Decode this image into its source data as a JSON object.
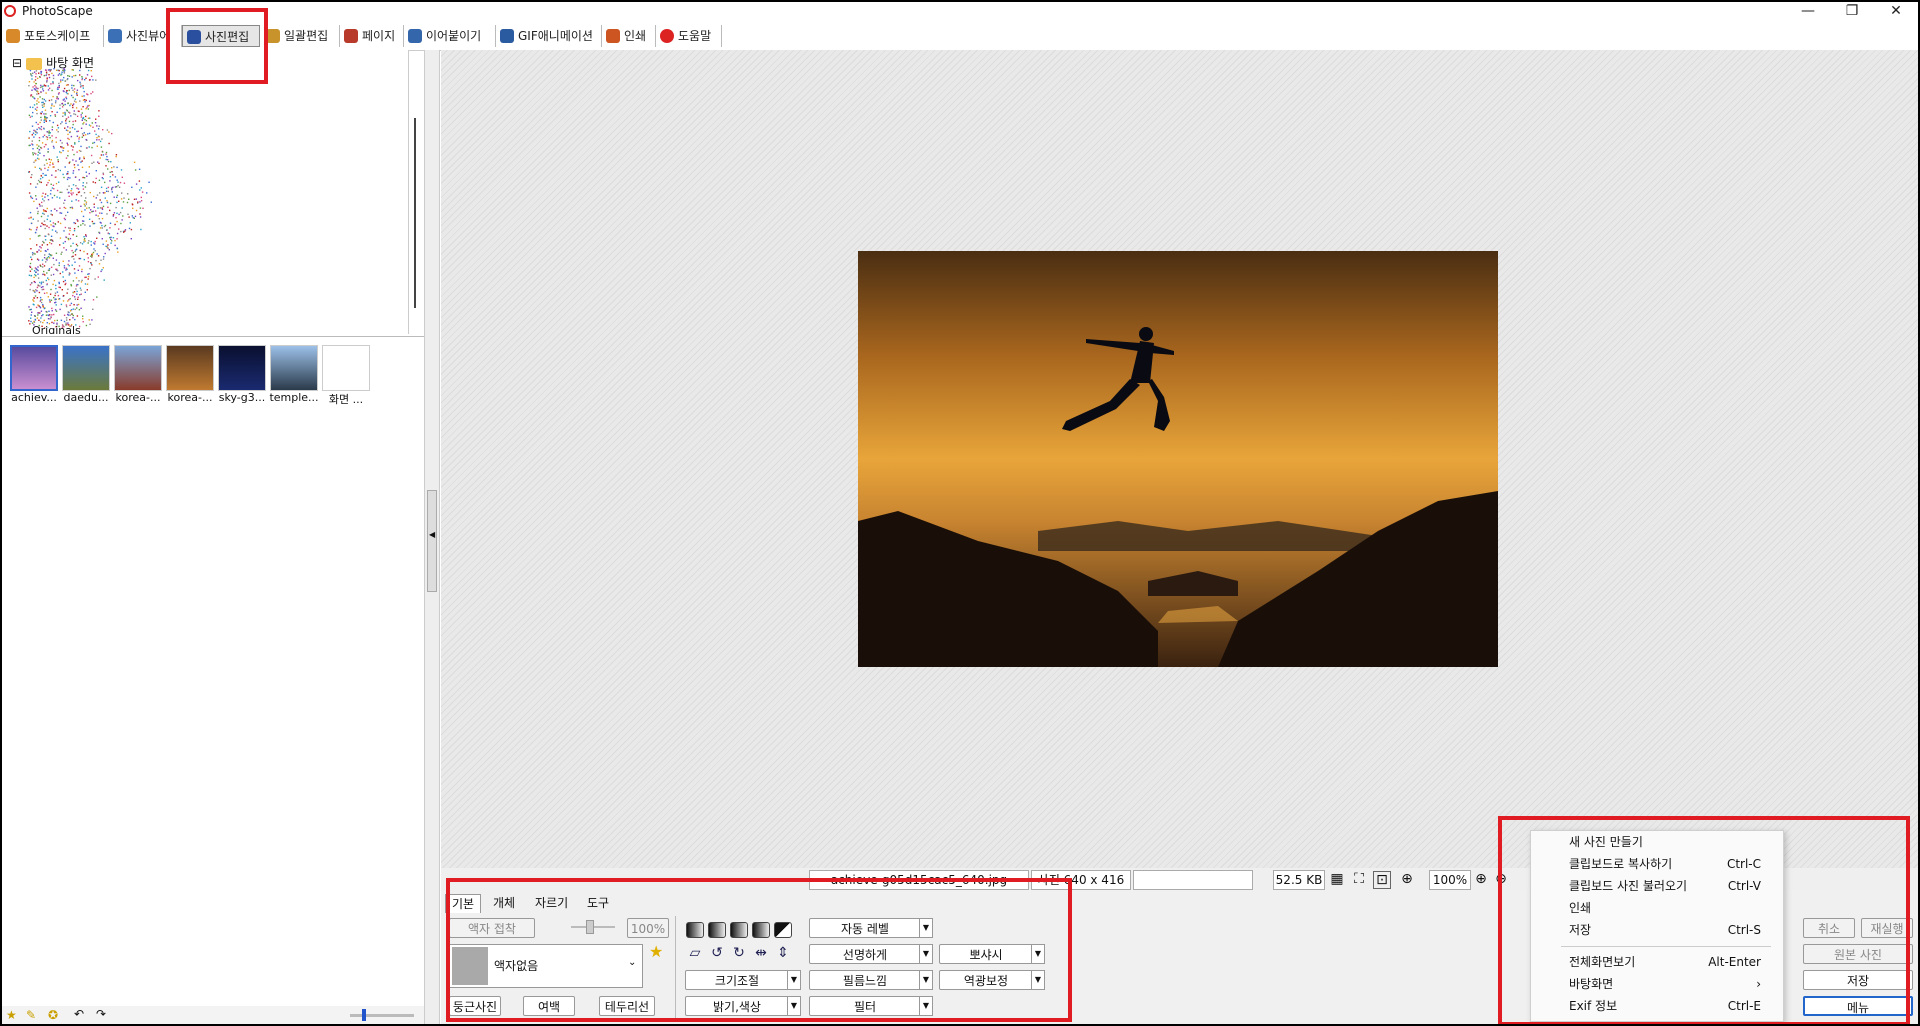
{
  "app": {
    "title": "PhotoScape"
  },
  "window": {
    "minimize": "—",
    "maximize": "❐",
    "close": "✕"
  },
  "tabs": [
    {
      "label": "포토스케이프",
      "color": "#d88a2a"
    },
    {
      "label": "사진뷰어",
      "color": "#3b6fb6"
    },
    {
      "label": "사진편집",
      "color": "#2a4f9e"
    },
    {
      "label": "일괄편집",
      "color": "#c9932b"
    },
    {
      "label": "페이지",
      "color": "#b83a2a"
    },
    {
      "label": "이어붙이기",
      "color": "#3366aa"
    },
    {
      "label": "GIF애니메이션",
      "color": "#2a5aa0"
    },
    {
      "label": "인쇄",
      "color": "#cc5522"
    },
    {
      "label": "도움말",
      "color": "#dd2222"
    }
  ],
  "tree": {
    "root_label": "바탕 화면",
    "expand": "⊟",
    "child_label": "Originals"
  },
  "thumbnails": [
    {
      "label": "achiev...",
      "colors": [
        "#5a4b9e",
        "#c98fd0"
      ]
    },
    {
      "label": "daedu...",
      "colors": [
        "#3a73c9",
        "#6b7a3a"
      ]
    },
    {
      "label": "korea-...",
      "colors": [
        "#7aa4d8",
        "#8a3b2a"
      ]
    },
    {
      "label": "korea-...",
      "colors": [
        "#5a3a20",
        "#c07a30"
      ]
    },
    {
      "label": "sky-g3...",
      "colors": [
        "#0a1030",
        "#1a2a70"
      ]
    },
    {
      "label": "temple...",
      "colors": [
        "#9cc0e8",
        "#2a3a4a"
      ]
    },
    {
      "label": "화면 ...",
      "colors": [
        "#ffffff",
        "#ffffff"
      ]
    }
  ],
  "status": {
    "filename": "achieve-g05d15cac5_640.jpg",
    "dimensions": "사진 640 x 416",
    "filesize": "52.5 KB",
    "zoom": "100%"
  },
  "bottom_tabs": [
    "기본",
    "개체",
    "자르기",
    "도구"
  ],
  "editor": {
    "frame_button": "액자 접착",
    "opacity_value": "100%",
    "frame_select": "액자없음",
    "round_photo": "둥근사진",
    "margin": "여백",
    "border": "테두리선",
    "auto_level": "자동 레벨",
    "sharpen": "선명하게",
    "bloom": "뽀샤시",
    "resize": "크기조절",
    "film": "필름느낌",
    "backlight": "역광보정",
    "brightness": "밝기,색상",
    "filter": "필터"
  },
  "right_buttons": {
    "undo": "취소",
    "redo": "재실행",
    "original": "원본 사진",
    "save": "저장",
    "menu": "메뉴"
  },
  "context_menu": [
    {
      "label": "새 사진 만들기",
      "shortcut": ""
    },
    {
      "label": "클립보드로 복사하기",
      "shortcut": "Ctrl-C"
    },
    {
      "label": "클립보드 사진 불러오기",
      "shortcut": "Ctrl-V"
    },
    {
      "label": "인쇄",
      "shortcut": ""
    },
    {
      "label": "저장",
      "shortcut": "Ctrl-S"
    },
    {
      "label": "전체화면보기",
      "shortcut": "Alt-Enter"
    },
    {
      "label": "바탕화면",
      "shortcut": "›"
    },
    {
      "label": "Exif 정보",
      "shortcut": "Ctrl-E"
    }
  ]
}
